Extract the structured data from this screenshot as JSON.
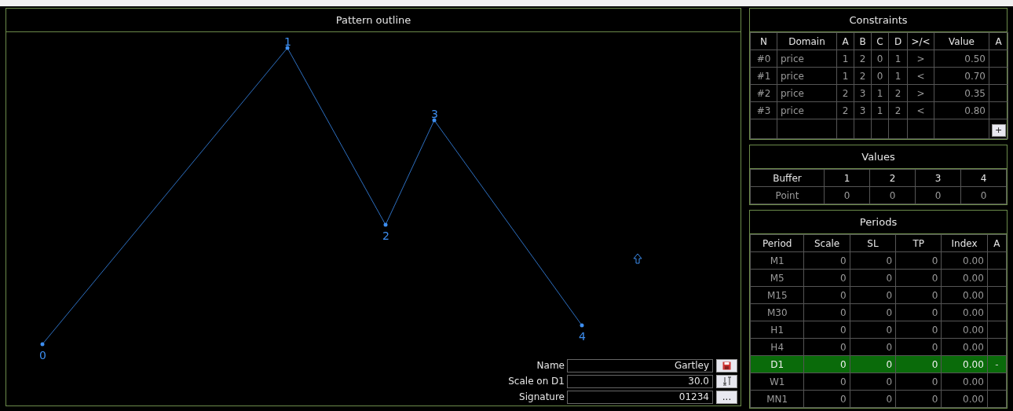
{
  "pattern": {
    "title": "Pattern outline",
    "point_labels": [
      "0",
      "1",
      "2",
      "3",
      "4"
    ],
    "fields": [
      {
        "label": "Name",
        "value": "Gartley",
        "kind": "save"
      },
      {
        "label": "Scale on D1",
        "value": "30.0",
        "kind": "sort"
      },
      {
        "label": "Signature",
        "value": "01234",
        "kind": "more",
        "button_text": "..."
      }
    ]
  },
  "constraints": {
    "title": "Constraints",
    "columns": [
      "N",
      "Domain",
      "A",
      "B",
      "C",
      "D",
      ">/<",
      "Value",
      "A"
    ],
    "rows": [
      [
        "#0",
        "price",
        "1",
        "2",
        "0",
        "1",
        ">",
        "0.50"
      ],
      [
        "#1",
        "price",
        "1",
        "2",
        "0",
        "1",
        "<",
        "0.70"
      ],
      [
        "#2",
        "price",
        "2",
        "3",
        "1",
        "2",
        ">",
        "0.35"
      ],
      [
        "#3",
        "price",
        "2",
        "3",
        "1",
        "2",
        "<",
        "0.80"
      ]
    ],
    "add_button": "+"
  },
  "values": {
    "title": "Values",
    "columns": [
      "Buffer",
      "1",
      "2",
      "3",
      "4"
    ],
    "rows": [
      [
        "Point",
        "0",
        "0",
        "0",
        "0"
      ]
    ]
  },
  "periods": {
    "title": "Periods",
    "columns": [
      "Period",
      "Scale",
      "SL",
      "TP",
      "Index",
      "A"
    ],
    "rows": [
      {
        "cells": [
          "M1",
          "0",
          "0",
          "0",
          "0.00"
        ],
        "selected": false
      },
      {
        "cells": [
          "M5",
          "0",
          "0",
          "0",
          "0.00"
        ],
        "selected": false
      },
      {
        "cells": [
          "M15",
          "0",
          "0",
          "0",
          "0.00"
        ],
        "selected": false
      },
      {
        "cells": [
          "M30",
          "0",
          "0",
          "0",
          "0.00"
        ],
        "selected": false
      },
      {
        "cells": [
          "H1",
          "0",
          "0",
          "0",
          "0.00"
        ],
        "selected": false
      },
      {
        "cells": [
          "H4",
          "0",
          "0",
          "0",
          "0.00"
        ],
        "selected": false
      },
      {
        "cells": [
          "D1",
          "0",
          "0",
          "0",
          "0.00"
        ],
        "selected": true,
        "a": "-"
      },
      {
        "cells": [
          "W1",
          "0",
          "0",
          "0",
          "0.00"
        ],
        "selected": false
      },
      {
        "cells": [
          "MN1",
          "0",
          "0",
          "0",
          "0.00"
        ],
        "selected": false
      }
    ]
  }
}
